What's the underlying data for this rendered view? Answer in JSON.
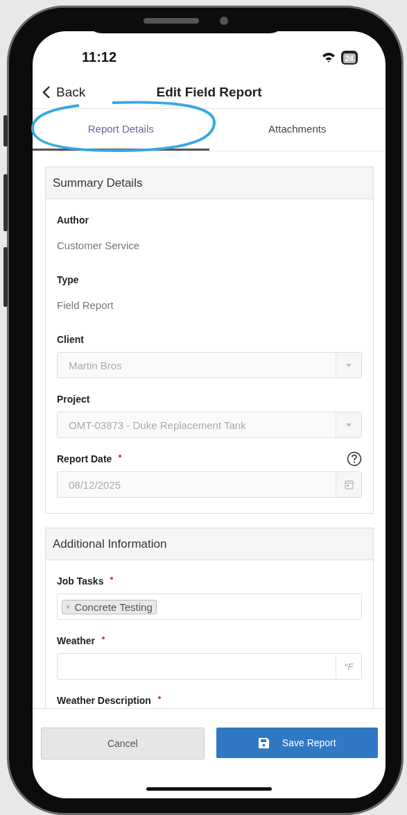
{
  "status_bar": {
    "time": "11:12",
    "battery": "24"
  },
  "nav": {
    "back": "Back",
    "title": "Edit Field Report"
  },
  "tabs": [
    {
      "label": "Report Details",
      "selected": true
    },
    {
      "label": "Attachments",
      "selected": false
    }
  ],
  "sections": [
    {
      "title": "Summary Details",
      "fields": [
        {
          "kind": "text",
          "label": "Author",
          "value": "Customer Service"
        },
        {
          "kind": "text",
          "label": "Type",
          "value": "Field Report"
        },
        {
          "kind": "select",
          "label": "Client",
          "value": "Martin Bros",
          "disabled": true
        },
        {
          "kind": "select",
          "label": "Project",
          "value": "OMT-03873 - Duke Replacement Tank",
          "disabled": true
        },
        {
          "kind": "date",
          "label": "Report Date",
          "required": true,
          "help": true,
          "value": "08/12/2025",
          "disabled": true
        }
      ]
    },
    {
      "title": "Additional Information",
      "fields": [
        {
          "kind": "tags",
          "label": "Job Tasks",
          "required": true,
          "tags": [
            {
              "remove": "×",
              "label": "Concrete Testing"
            }
          ]
        },
        {
          "kind": "unit",
          "label": "Weather",
          "required": true,
          "unit": "°F"
        },
        {
          "kind": "heading",
          "label": "Weather Description",
          "required": true
        }
      ]
    }
  ],
  "actions": [
    {
      "kind": "cancel",
      "label": "Cancel"
    },
    {
      "kind": "save",
      "label": "Save Report"
    }
  ]
}
